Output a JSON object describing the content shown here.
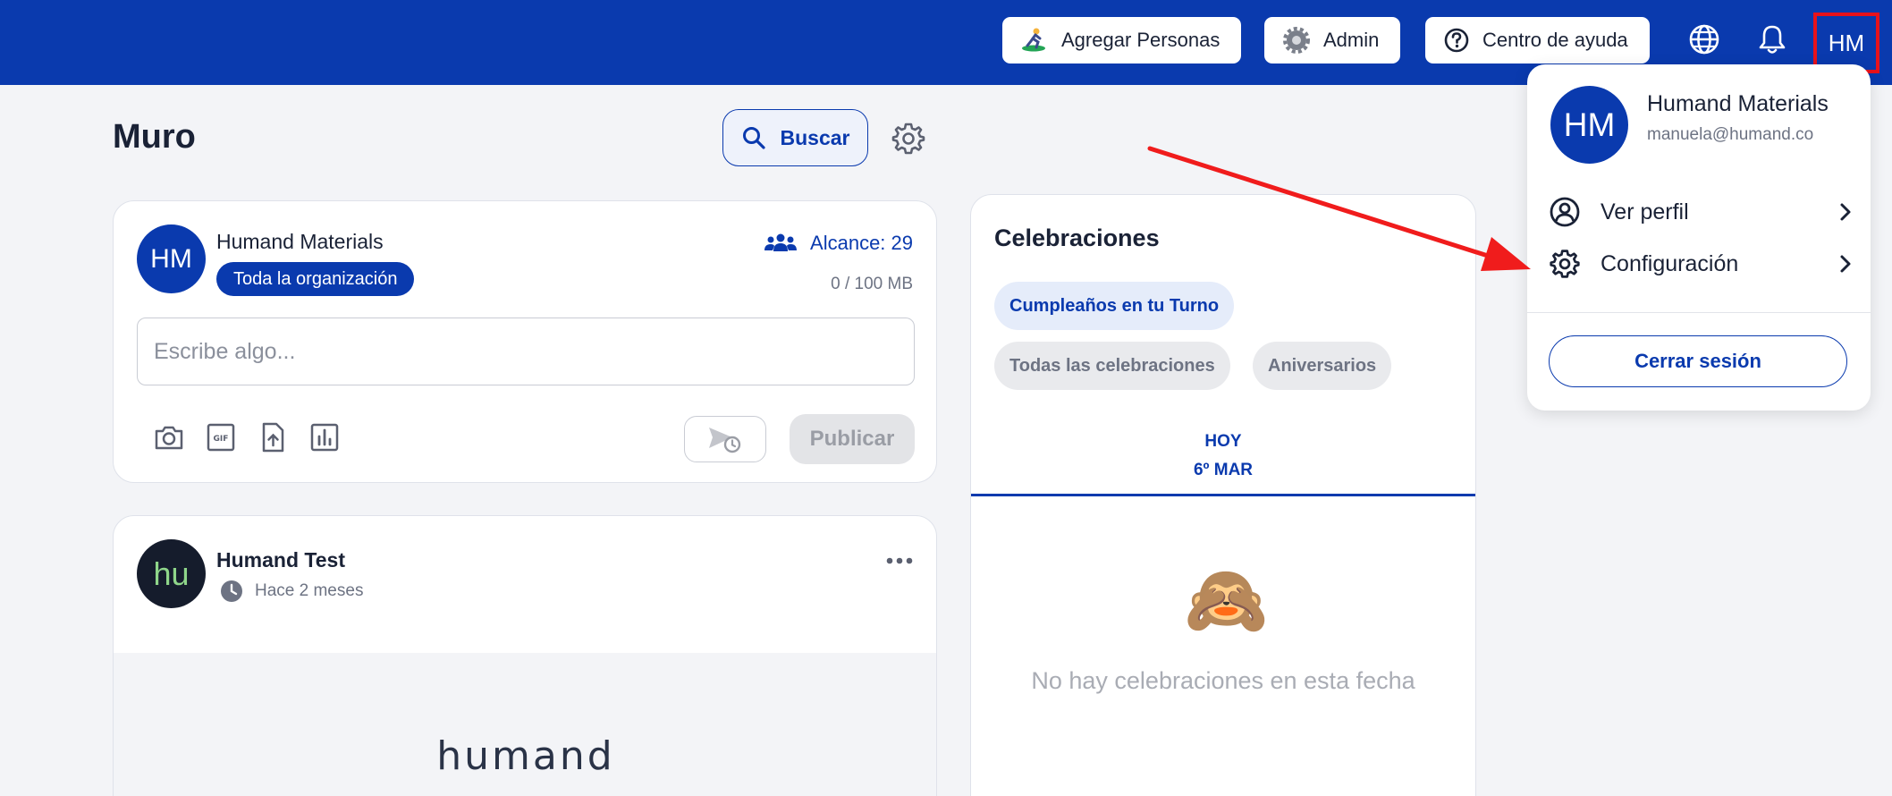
{
  "colors": {
    "brand_blue": "#0a3aae",
    "highlight_red": "#e8121b",
    "arrow_red": "#f01c1c"
  },
  "topbar": {
    "add_people_label": "Agregar Personas",
    "admin_label": "Admin",
    "help_center_label": "Centro de ayuda",
    "user_initials": "HM",
    "icons": [
      "surfer-icon",
      "gear-icon",
      "question-circle-icon",
      "globe-icon",
      "bell-icon"
    ]
  },
  "page": {
    "title": "Muro",
    "search_label": "Buscar"
  },
  "composer": {
    "avatar_initials": "HM",
    "author": "Humand Materials",
    "audience": "Toda la organización",
    "reach": "Alcance: 29",
    "storage": "0 / 100 MB",
    "placeholder": "Escribe algo...",
    "publish_label": "Publicar",
    "tools": [
      "camera-icon",
      "gif-icon",
      "file-upload-icon",
      "poll-icon"
    ]
  },
  "post": {
    "avatar_initials": "hu",
    "author": "Humand Test",
    "time": "Hace 2 meses",
    "brand": "humand"
  },
  "celebrations": {
    "title": "Celebraciones",
    "chips": [
      "Cumpleaños en tu Turno",
      "Todas las celebraciones",
      "Aniversarios"
    ],
    "active_chip": "Cumpleaños en tu Turno",
    "tab_label": "HOY",
    "tab_date": "6º MAR",
    "empty_emoji": "🙈",
    "empty_message": "No hay celebraciones en esta fecha"
  },
  "user_menu": {
    "avatar_initials": "HM",
    "name": "Humand Materials",
    "email": "manuela@humand.co",
    "items": [
      "Ver perfil",
      "Configuración"
    ],
    "logout_label": "Cerrar sesión"
  }
}
